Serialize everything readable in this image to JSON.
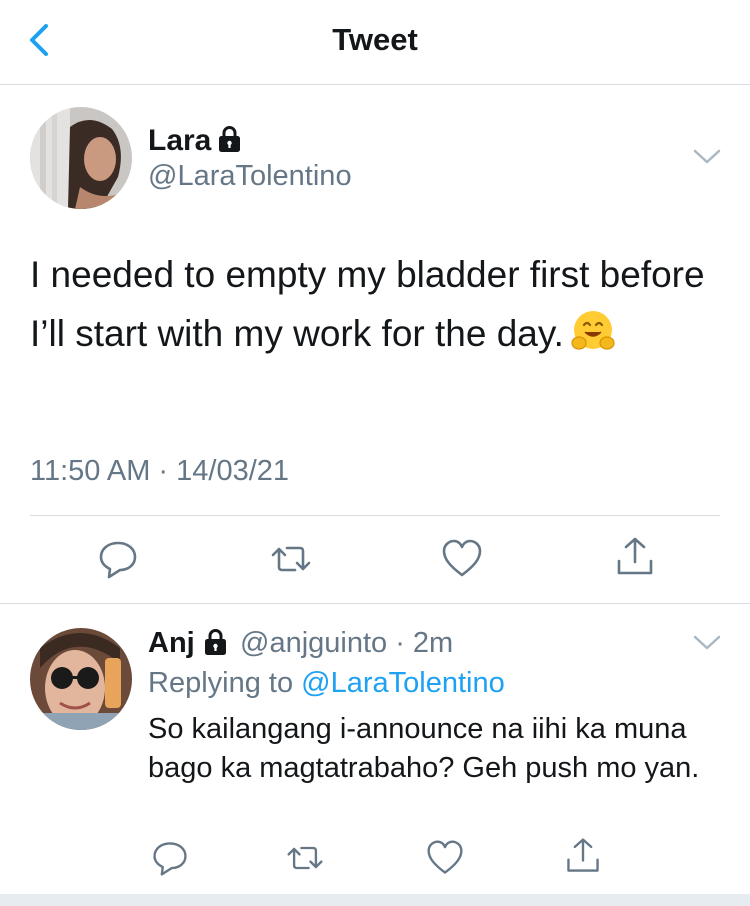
{
  "header": {
    "title": "Tweet"
  },
  "tweet": {
    "author_name": "Lara",
    "author_handle": "@LaraTolentino",
    "text": "I needed to empty my bladder first before I’ll start with my work for the day.",
    "timestamp": "11:50 AM · 14/03/21",
    "emoji_icon": "hugging-face-icon"
  },
  "actions": [
    "reply-icon",
    "retweet-icon",
    "like-icon",
    "share-icon"
  ],
  "reply": {
    "author_name": "Anj",
    "author_handle": "@anjguinto",
    "meta_suffix": " · 2m",
    "replying_prefix": "Replying to ",
    "replying_target": "@LaraTolentino",
    "text": "So kailangang i-announce na iihi ka muna bago ka magtatrabaho? Geh push mo yan."
  },
  "colors": {
    "accent": "#1da1f2",
    "secondary_text": "#657786",
    "divider": "#d9dde0"
  }
}
